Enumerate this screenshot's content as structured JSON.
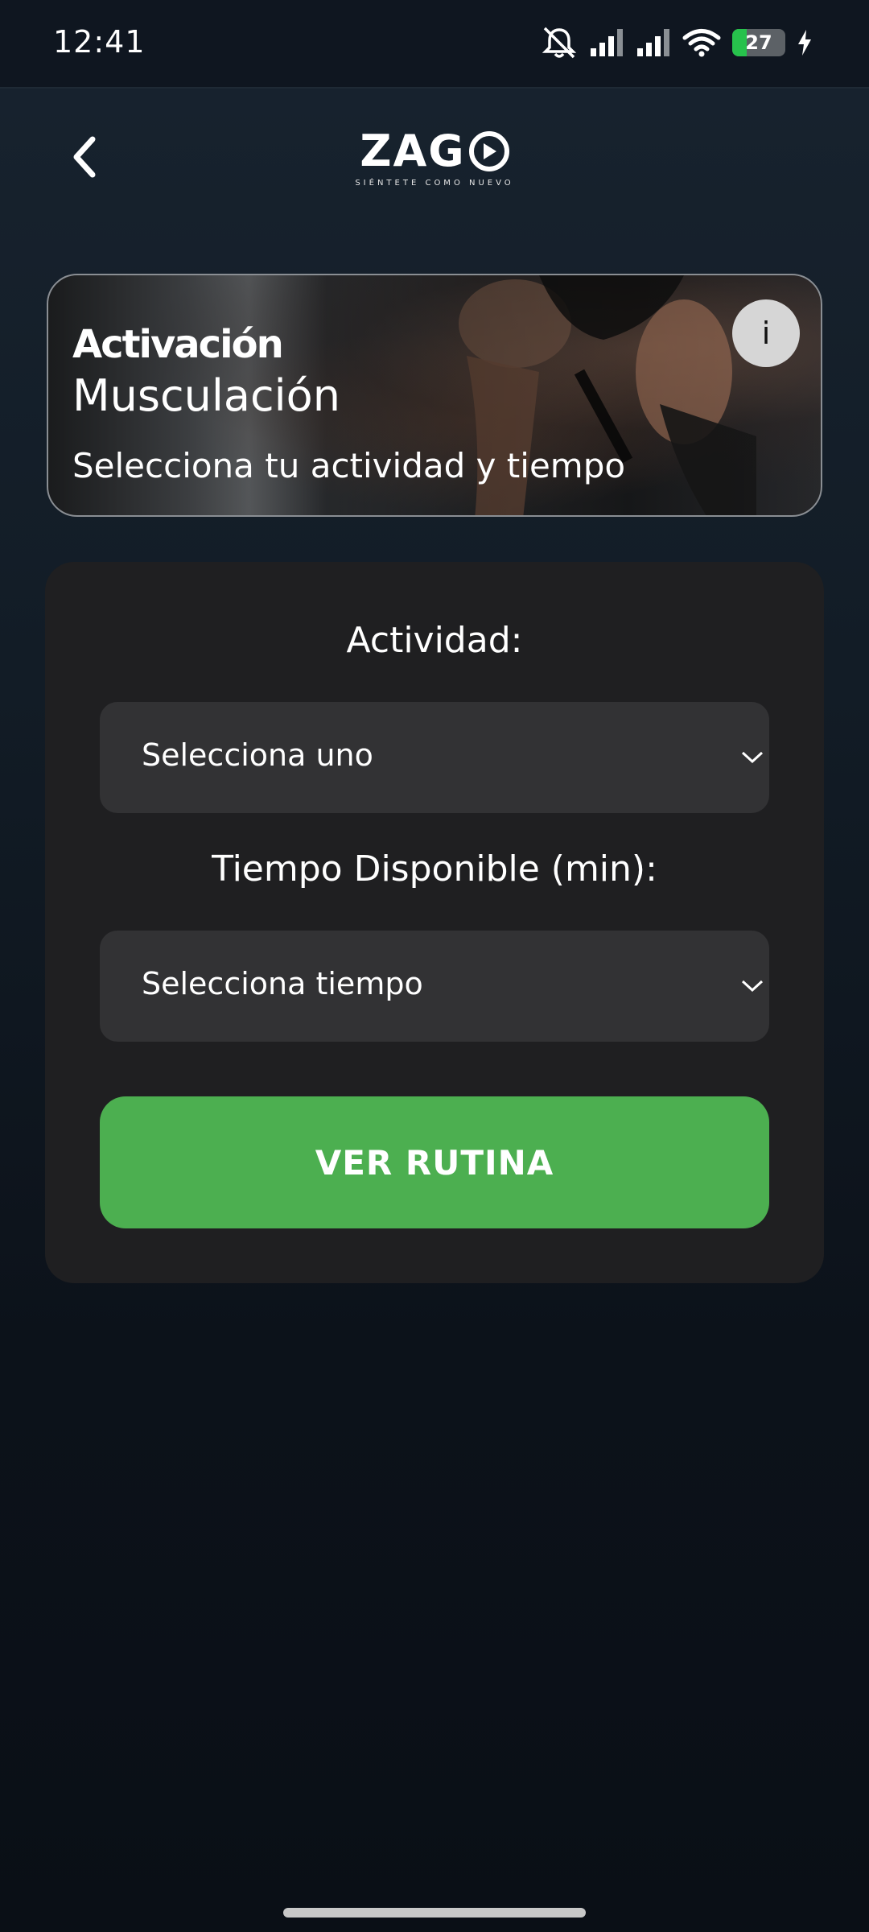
{
  "status_bar": {
    "time": "12:41",
    "battery_level": 27,
    "battery_text": "27",
    "icons": [
      "bell-off-icon",
      "signal-icon",
      "signal-icon",
      "wifi-icon",
      "battery-icon",
      "charging-icon"
    ]
  },
  "header": {
    "back_icon": "chevron-left-icon",
    "logo_text": "ZAG",
    "logo_tagline": "SIÉNTETE COMO NUEVO"
  },
  "banner": {
    "kicker": "Activación",
    "title": "Musculación",
    "subtitle": "Selecciona tu actividad y tiempo",
    "info_label": "i"
  },
  "form": {
    "activity_label": "Actividad:",
    "activity_value": "Selecciona uno",
    "time_label": "Tiempo Disponible (min):",
    "time_value": "Selecciona tiempo",
    "submit_label": "VER RUTINA"
  },
  "colors": {
    "accent": "#4caf50",
    "card": "#1f1f21",
    "select_bg": "#323234",
    "background_top": "#18232f",
    "background_bottom": "#0a0f16"
  }
}
